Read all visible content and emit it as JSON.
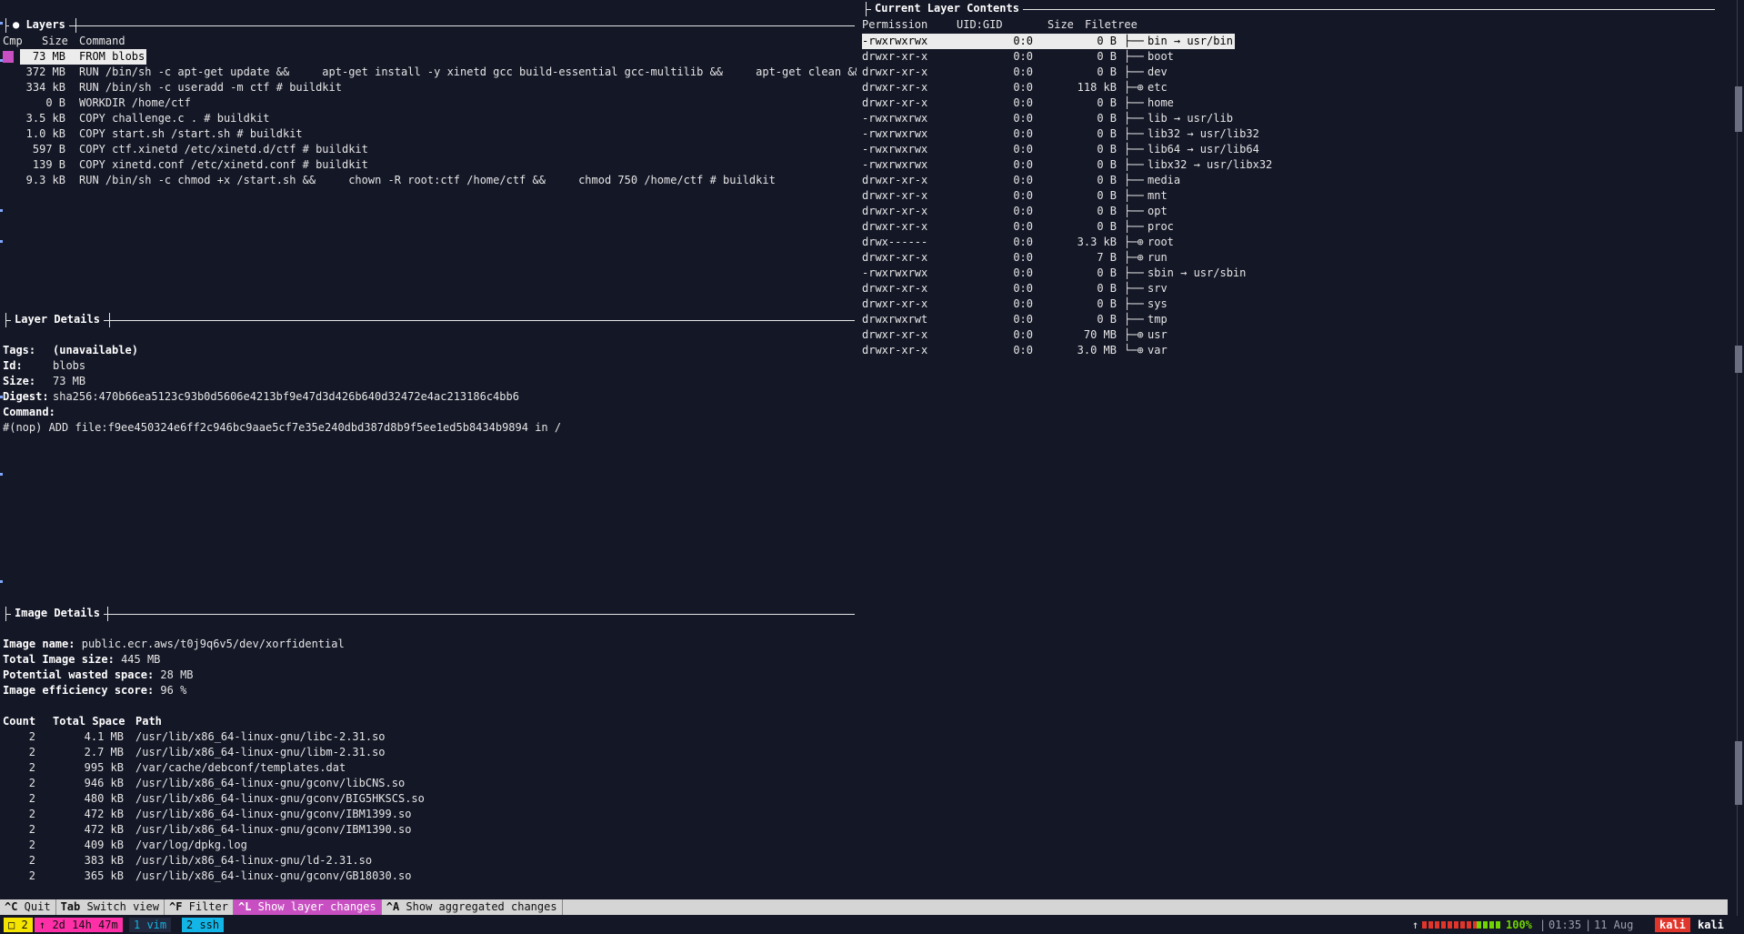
{
  "layers_panel": {
    "title": "● Layers",
    "headers": {
      "cmp": "Cmp",
      "size": "Size",
      "command": "Command"
    },
    "rows": [
      {
        "size": "73 MB",
        "command": "FROM blobs"
      },
      {
        "size": "372 MB",
        "command": "RUN /bin/sh -c apt-get update &&     apt-get install -y xinetd gcc build-essential gcc-multilib &&     apt-get clean && rm"
      },
      {
        "size": "334 kB",
        "command": "RUN /bin/sh -c useradd -m ctf # buildkit"
      },
      {
        "size": "0 B",
        "command": "WORKDIR /home/ctf"
      },
      {
        "size": "3.5 kB",
        "command": "COPY challenge.c . # buildkit"
      },
      {
        "size": "1.0 kB",
        "command": "COPY start.sh /start.sh # buildkit"
      },
      {
        "size": "597 B",
        "command": "COPY ctf.xinetd /etc/xinetd.d/ctf # buildkit"
      },
      {
        "size": "139 B",
        "command": "COPY xinetd.conf /etc/xinetd.conf # buildkit"
      },
      {
        "size": "9.3 kB",
        "command": "RUN /bin/sh -c chmod +x /start.sh &&     chown -R root:ctf /home/ctf &&     chmod 750 /home/ctf # buildkit"
      }
    ]
  },
  "layer_details": {
    "title": "Layer Details",
    "tags_label": "Tags:",
    "tags_value": "(unavailable)",
    "id_label": "Id:",
    "id_value": "blobs",
    "size_label": "Size:",
    "size_value": "73 MB",
    "digest_label": "Digest:",
    "digest_value": "sha256:470b66ea5123c93b0d5606e4213bf9e47d3d426b640d32472e4ac213186c4bb6",
    "command_label": "Command:",
    "command_value": "#(nop) ADD file:f9ee450324e6ff2c946bc9aae5cf7e35e240dbd387d8b9f5ee1ed5b8434b9894 in /"
  },
  "image_details": {
    "title": "Image Details",
    "name_label": "Image name:",
    "name_value": "public.ecr.aws/t0j9q6v5/dev/xorfidential",
    "total_label": "Total Image size:",
    "total_value": "445 MB",
    "wasted_label": "Potential wasted space:",
    "wasted_value": "28 MB",
    "efficiency_label": "Image efficiency score:",
    "efficiency_value": "96 %",
    "headers": {
      "count": "Count",
      "space": "Total Space",
      "path": "Path"
    },
    "rows": [
      {
        "count": "2",
        "space": "4.1 MB",
        "path": "/usr/lib/x86_64-linux-gnu/libc-2.31.so"
      },
      {
        "count": "2",
        "space": "2.7 MB",
        "path": "/usr/lib/x86_64-linux-gnu/libm-2.31.so"
      },
      {
        "count": "2",
        "space": "995 kB",
        "path": "/var/cache/debconf/templates.dat"
      },
      {
        "count": "2",
        "space": "946 kB",
        "path": "/usr/lib/x86_64-linux-gnu/gconv/libCNS.so"
      },
      {
        "count": "2",
        "space": "480 kB",
        "path": "/usr/lib/x86_64-linux-gnu/gconv/BIG5HKSCS.so"
      },
      {
        "count": "2",
        "space": "472 kB",
        "path": "/usr/lib/x86_64-linux-gnu/gconv/IBM1399.so"
      },
      {
        "count": "2",
        "space": "472 kB",
        "path": "/usr/lib/x86_64-linux-gnu/gconv/IBM1390.so"
      },
      {
        "count": "2",
        "space": "409 kB",
        "path": "/var/log/dpkg.log"
      },
      {
        "count": "2",
        "space": "383 kB",
        "path": "/usr/lib/x86_64-linux-gnu/ld-2.31.so"
      },
      {
        "count": "2",
        "space": "365 kB",
        "path": "/usr/lib/x86_64-linux-gnu/gconv/GB18030.so"
      }
    ]
  },
  "contents_panel": {
    "title": "Current Layer Contents",
    "headers": {
      "perm": "Permission",
      "uid": "UID:GID",
      "size": "Size",
      "tree": "Filetree"
    },
    "rows": [
      {
        "perm": "-rwxrwxrwx",
        "uid": "0:0",
        "size": "0 B",
        "branch": "├──",
        "name": "bin → usr/bin"
      },
      {
        "perm": "drwxr-xr-x",
        "uid": "0:0",
        "size": "0 B",
        "branch": "├──",
        "name": "boot"
      },
      {
        "perm": "drwxr-xr-x",
        "uid": "0:0",
        "size": "0 B",
        "branch": "├──",
        "name": "dev"
      },
      {
        "perm": "drwxr-xr-x",
        "uid": "0:0",
        "size": "118 kB",
        "branch": "├─⊕",
        "name": "etc"
      },
      {
        "perm": "drwxr-xr-x",
        "uid": "0:0",
        "size": "0 B",
        "branch": "├──",
        "name": "home"
      },
      {
        "perm": "-rwxrwxrwx",
        "uid": "0:0",
        "size": "0 B",
        "branch": "├──",
        "name": "lib → usr/lib"
      },
      {
        "perm": "-rwxrwxrwx",
        "uid": "0:0",
        "size": "0 B",
        "branch": "├──",
        "name": "lib32 → usr/lib32"
      },
      {
        "perm": "-rwxrwxrwx",
        "uid": "0:0",
        "size": "0 B",
        "branch": "├──",
        "name": "lib64 → usr/lib64"
      },
      {
        "perm": "-rwxrwxrwx",
        "uid": "0:0",
        "size": "0 B",
        "branch": "├──",
        "name": "libx32 → usr/libx32"
      },
      {
        "perm": "drwxr-xr-x",
        "uid": "0:0",
        "size": "0 B",
        "branch": "├──",
        "name": "media"
      },
      {
        "perm": "drwxr-xr-x",
        "uid": "0:0",
        "size": "0 B",
        "branch": "├──",
        "name": "mnt"
      },
      {
        "perm": "drwxr-xr-x",
        "uid": "0:0",
        "size": "0 B",
        "branch": "├──",
        "name": "opt"
      },
      {
        "perm": "drwxr-xr-x",
        "uid": "0:0",
        "size": "0 B",
        "branch": "├──",
        "name": "proc"
      },
      {
        "perm": "drwx------",
        "uid": "0:0",
        "size": "3.3 kB",
        "branch": "├─⊕",
        "name": "root"
      },
      {
        "perm": "drwxr-xr-x",
        "uid": "0:0",
        "size": "7 B",
        "branch": "├─⊕",
        "name": "run"
      },
      {
        "perm": "-rwxrwxrwx",
        "uid": "0:0",
        "size": "0 B",
        "branch": "├──",
        "name": "sbin → usr/sbin"
      },
      {
        "perm": "drwxr-xr-x",
        "uid": "0:0",
        "size": "0 B",
        "branch": "├──",
        "name": "srv"
      },
      {
        "perm": "drwxr-xr-x",
        "uid": "0:0",
        "size": "0 B",
        "branch": "├──",
        "name": "sys"
      },
      {
        "perm": "drwxrwxrwt",
        "uid": "0:0",
        "size": "0 B",
        "branch": "├──",
        "name": "tmp"
      },
      {
        "perm": "drwxr-xr-x",
        "uid": "0:0",
        "size": "70 MB",
        "branch": "├─⊕",
        "name": "usr"
      },
      {
        "perm": "drwxr-xr-x",
        "uid": "0:0",
        "size": "3.0 MB",
        "branch": "└─⊕",
        "name": "var"
      }
    ]
  },
  "keybar": [
    {
      "key": "^C",
      "label": "Quit"
    },
    {
      "key": "Tab",
      "label": "Switch view"
    },
    {
      "key": "^F",
      "label": "Filter"
    },
    {
      "key": "^L",
      "label": "Show layer changes",
      "active": true
    },
    {
      "key": "^A",
      "label": "Show aggregated changes"
    }
  ],
  "tmux": {
    "session": "□ 2",
    "uptime": "↑ 2d 14h 47m",
    "win1": "1 vim",
    "win2": "2 ssh",
    "battery_arrow": "↑",
    "battery": "100%",
    "time": "01:35",
    "date": "11 Aug",
    "host1": "kali",
    "host2": "kali"
  },
  "colors": {
    "bg": "#141726",
    "accent": "#c84fc2",
    "tmux_yellow": "#f5e400",
    "tmux_pink": "#ff2fa8",
    "tmux_cyan": "#12b5e6",
    "battery_red": "#e0352b",
    "battery_green": "#6fd400"
  }
}
